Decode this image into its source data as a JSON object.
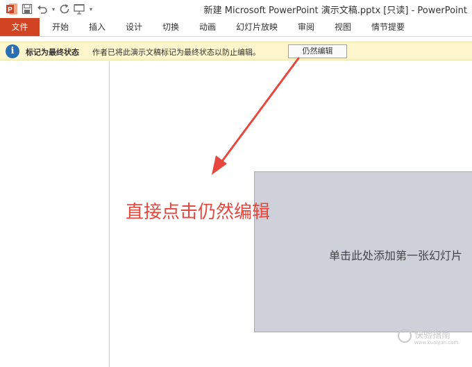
{
  "window": {
    "title": "新建 Microsoft PowerPoint 演示文稿.pptx [只读] - PowerPoint"
  },
  "quick_access": {
    "icons": [
      "powerpoint-logo-icon",
      "save-icon",
      "undo-icon",
      "redo-icon",
      "start-from-beginning-icon",
      "customize-toolbar-icon"
    ]
  },
  "ribbon": {
    "tabs": [
      {
        "label": "文件"
      },
      {
        "label": "开始"
      },
      {
        "label": "插入"
      },
      {
        "label": "设计"
      },
      {
        "label": "切换"
      },
      {
        "label": "动画"
      },
      {
        "label": "幻灯片放映"
      },
      {
        "label": "审阅"
      },
      {
        "label": "视图"
      },
      {
        "label": "情节提要"
      }
    ],
    "file_tab_color": "#d04423"
  },
  "message_bar": {
    "title": "标记为最终状态",
    "text": "作者已将此演示文稿标记为最终状态以防止编辑。",
    "button_label": "仍然编辑",
    "background": "#fdf5cb"
  },
  "slide": {
    "placeholder": "单击此处添加第一张幻灯片"
  },
  "annotation": {
    "text": "直接点击仍然编辑",
    "color": "#e8473d"
  },
  "watermark": {
    "text": "快验指南",
    "sub": "www.kuaiyan.com"
  }
}
